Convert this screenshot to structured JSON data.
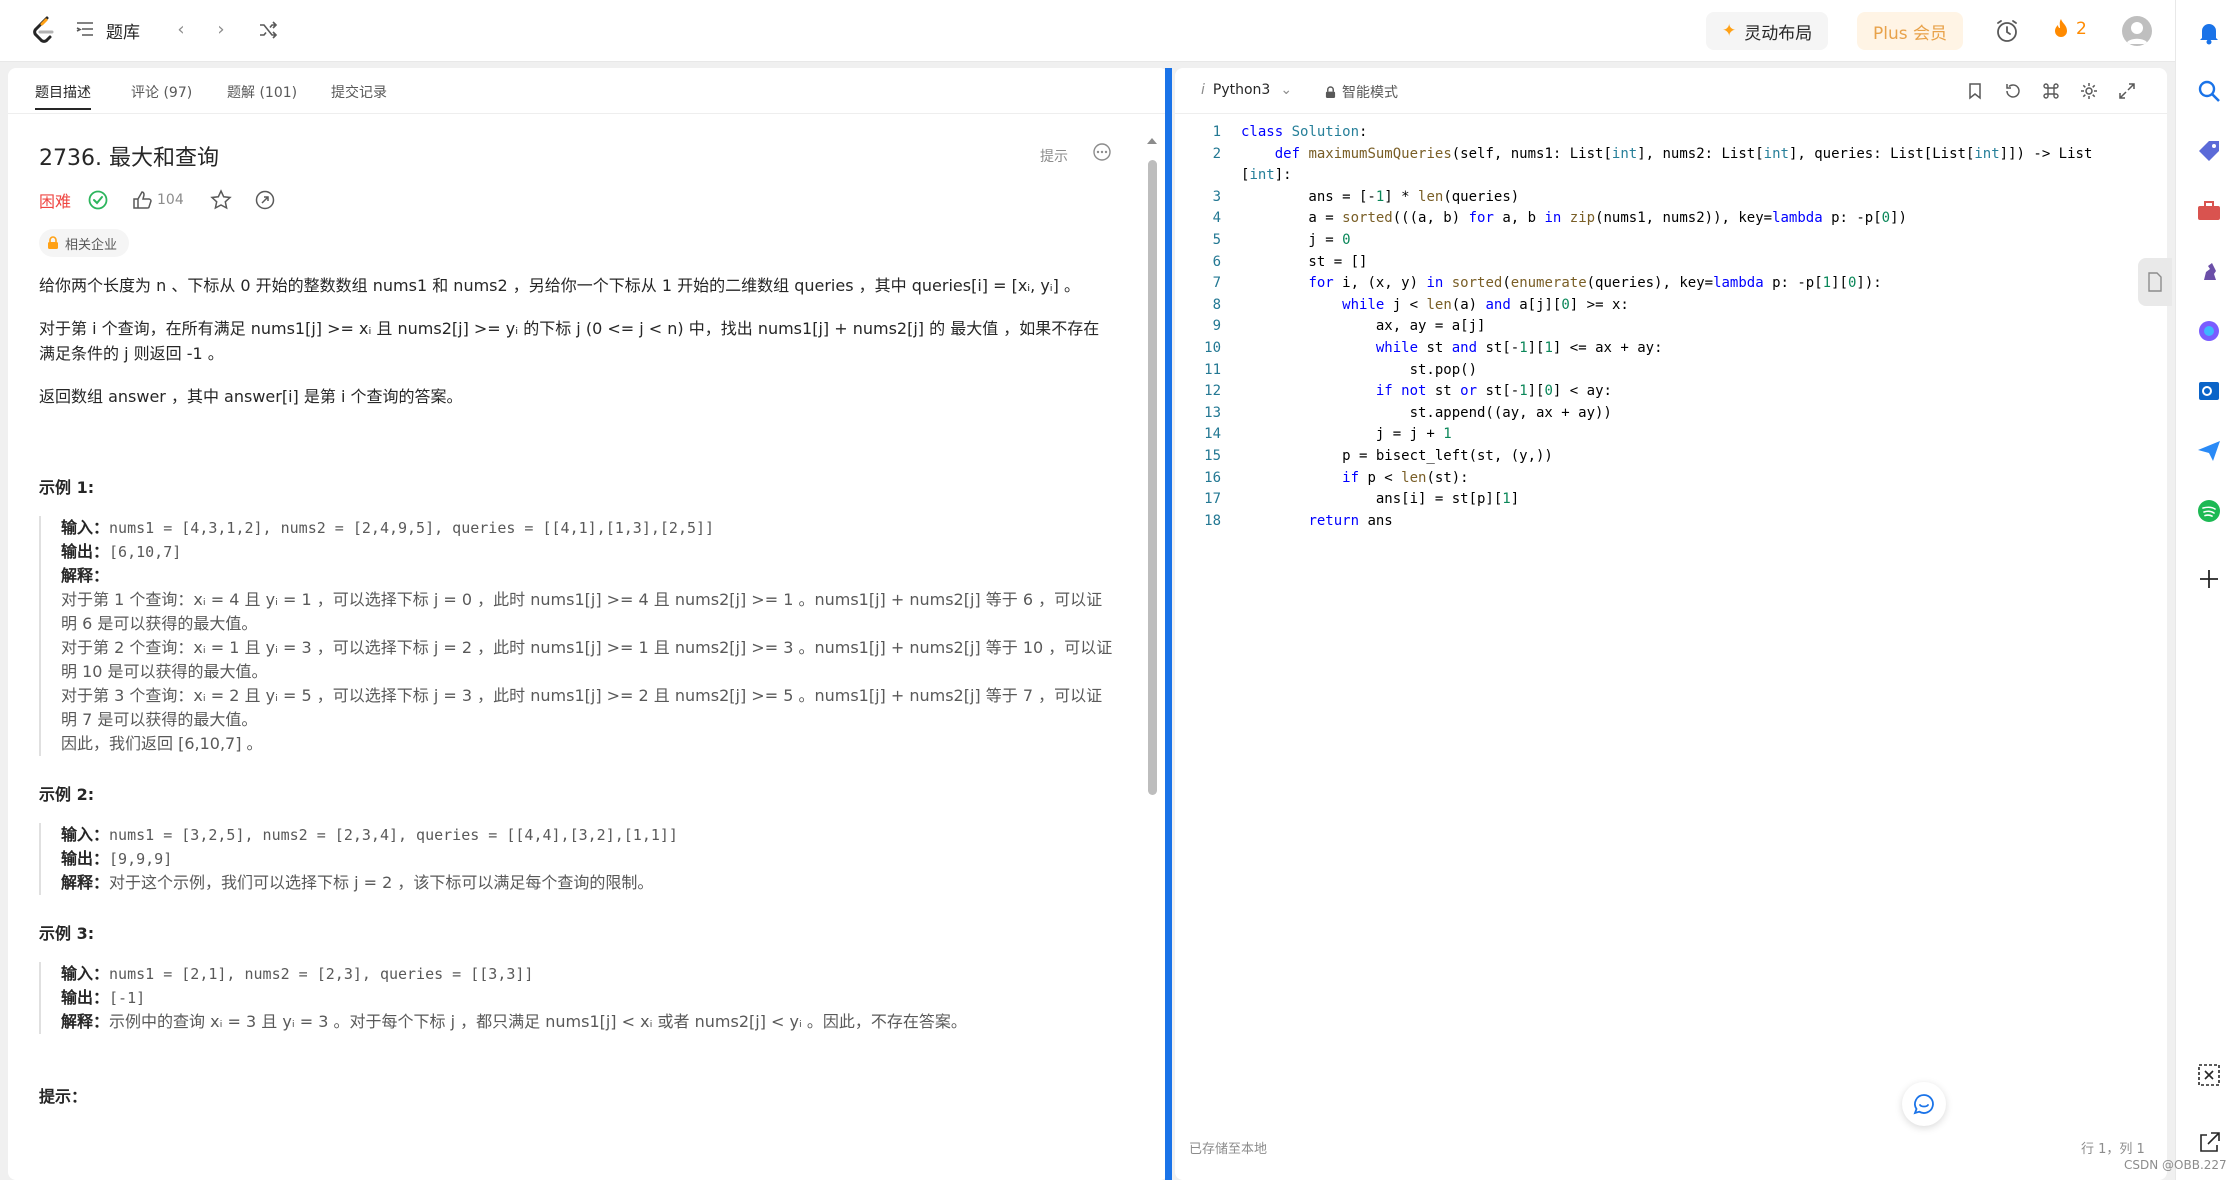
{
  "topbar": {
    "title": "题库",
    "layout_label": "灵动布局",
    "plus_label": "Plus 会员",
    "streak": "2"
  },
  "tabs": [
    "题目描述",
    "评论 (97)",
    "题解 (101)",
    "提交记录"
  ],
  "problem": {
    "title": "2736. 最大和查询",
    "hint": "提示",
    "difficulty": "困难",
    "likes": "104",
    "company_tag": "相关企业",
    "p1": "给你两个长度为 n 、下标从 0 开始的整数数组 nums1 和 nums2 ，另给你一个下标从 1 开始的二维数组 queries ，其中 queries[i] = [xᵢ, yᵢ] 。",
    "p2": "对于第 i 个查询，在所有满足 nums1[j] >= xᵢ 且 nums2[j] >= yᵢ 的下标 j (0 <= j < n) 中，找出 nums1[j] + nums2[j] 的 最大值 ，如果不存在满足条件的 j 则返回 -1 。",
    "p3": "返回数组 answer ，其中 answer[i] 是第 i 个查询的答案。",
    "examples": [
      {
        "title": "示例 1:",
        "input": "nums1 = [4,3,1,2], nums2 = [2,4,9,5], queries = [[4,1],[1,3],[2,5]]",
        "output": "[6,10,7]",
        "explain": [
          "对于第 1 个查询：xᵢ = 4 且 yᵢ = 1 ，可以选择下标 j = 0 ，此时 nums1[j] >= 4 且 nums2[j] >= 1 。nums1[j] + nums2[j] 等于 6 ，可以证明 6 是可以获得的最大值。",
          "对于第 2 个查询：xᵢ = 1 且 yᵢ = 3 ，可以选择下标 j = 2 ，此时 nums1[j] >= 1 且 nums2[j] >= 3 。nums1[j] + nums2[j] 等于 10 ，可以证明 10 是可以获得的最大值。",
          "对于第 3 个查询：xᵢ = 2 且 yᵢ = 5 ，可以选择下标 j = 3 ，此时 nums1[j] >= 2 且 nums2[j] >= 5 。nums1[j] + nums2[j] 等于 7 ，可以证明 7 是可以获得的最大值。",
          "因此，我们返回 [6,10,7] 。"
        ]
      },
      {
        "title": "示例 2:",
        "input": "nums1 = [3,2,5], nums2 = [2,3,4], queries = [[4,4],[3,2],[1,1]]",
        "output": "[9,9,9]",
        "explain": [
          "对于这个示例，我们可以选择下标 j = 2 ，该下标可以满足每个查询的限制。"
        ]
      },
      {
        "title": "示例 3:",
        "input": "nums1 = [2,1], nums2 = [2,3], queries = [[3,3]]",
        "output": "[-1]",
        "explain": [
          "示例中的查询 xᵢ = 3 且 yᵢ = 3 。对于每个下标 j ，都只满足 nums1[j] < xᵢ 或者 nums2[j] < yᵢ 。因此，不存在答案。"
        ]
      }
    ],
    "labels": {
      "input": "输入：",
      "output": "输出：",
      "explain": "解释：",
      "tips": "提示："
    }
  },
  "editor": {
    "language": "Python3",
    "mode": "智能模式",
    "saved": "已存储至本地",
    "cursor": "行 1，列 1",
    "code": [
      "class Solution:",
      "    def maximumSumQueries(self, nums1: List[int], nums2: List[int], queries: List[List[int]]) -> List",
      "[int]:",
      "        ans = [-1] * len(queries)",
      "        a = sorted(((a, b) for a, b in zip(nums1, nums2)), key=lambda p: -p[0])",
      "        j = 0",
      "        st = []",
      "        for i, (x, y) in sorted(enumerate(queries), key=lambda p: -p[1][0]):",
      "            while j < len(a) and a[j][0] >= x:",
      "                ax, ay = a[j]",
      "                while st and st[-1][1] <= ax + ay:",
      "                    st.pop()",
      "                if not st or st[-1][0] < ay:",
      "                    st.append((ay, ax + ay))",
      "                j = j + 1",
      "            p = bisect_left(st, (y,))",
      "            if p < len(st):",
      "                ans[i] = st[p][1]",
      "        return ans"
    ],
    "line_numbers": [
      "1",
      "2",
      "",
      "3",
      "4",
      "5",
      "6",
      "7",
      "8",
      "9",
      "10",
      "11",
      "12",
      "13",
      "14",
      "15",
      "16",
      "17",
      "18"
    ]
  },
  "watermark": "CSDN @OBB.227"
}
